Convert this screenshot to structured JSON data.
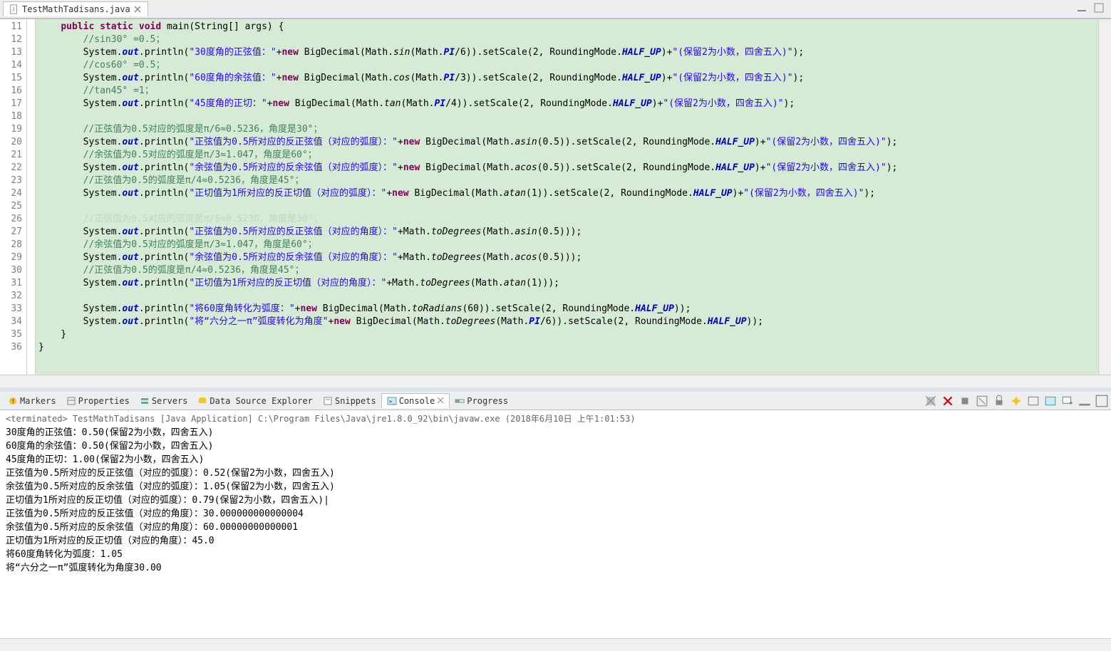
{
  "editor": {
    "tab": {
      "filename": "TestMathTadisans.java"
    },
    "lines": {
      "start": 11,
      "end": 36,
      "code": [
        {
          "n": 11,
          "html": "    <span class='kw'>public static void</span> main(String[] args) {"
        },
        {
          "n": 12,
          "html": "        <span class='com'>//sin30° =0.5；</span>"
        },
        {
          "n": 13,
          "html": "        System.<span class='fieldb'>out</span>.println(<span class='str'>\"30度角的正弦值：\"</span>+<span class='kw'>new</span> BigDecimal(Math.<span class='method-it'>sin</span>(Math.<span class='fieldb'>PI</span>/6)).setScale(2, RoundingMode.<span class='fieldb'>HALF_UP</span>)+<span class='str'>\"(保留2为小数，四舍五入)\"</span>);"
        },
        {
          "n": 14,
          "html": "        <span class='com'>//cos60° =0.5；</span>"
        },
        {
          "n": 15,
          "html": "        System.<span class='fieldb'>out</span>.println(<span class='str'>\"60度角的余弦值：\"</span>+<span class='kw'>new</span> BigDecimal(Math.<span class='method-it'>cos</span>(Math.<span class='fieldb'>PI</span>/3)).setScale(2, RoundingMode.<span class='fieldb'>HALF_UP</span>)+<span class='str'>\"(保留2为小数，四舍五入)\"</span>);"
        },
        {
          "n": 16,
          "html": "        <span class='com'>//tan45° =1；</span>"
        },
        {
          "n": 17,
          "html": "        System.<span class='fieldb'>out</span>.println(<span class='str'>\"45度角的正切：\"</span>+<span class='kw'>new</span> BigDecimal(Math.<span class='method-it'>tan</span>(Math.<span class='fieldb'>PI</span>/4)).setScale(2, RoundingMode.<span class='fieldb'>HALF_UP</span>)+<span class='str'>\"(保留2为小数，四舍五入)\"</span>);"
        },
        {
          "n": 18,
          "html": ""
        },
        {
          "n": 19,
          "html": "        <span class='com'>//正弦值为0.5对应的弧度是π/6≈0.5236，角度是30°；</span>"
        },
        {
          "n": 20,
          "html": "        System.<span class='fieldb'>out</span>.println(<span class='str'>\"正弦值为0.5所对应的反正弦值（对应的弧度）：\"</span>+<span class='kw'>new</span> BigDecimal(Math.<span class='method-it'>asin</span>(0.5)).setScale(2, RoundingMode.<span class='fieldb'>HALF_UP</span>)+<span class='str'>\"(保留2为小数，四舍五入)\"</span>);"
        },
        {
          "n": 21,
          "html": "        <span class='com'>//余弦值为0.5对应的弧度是π/3≈1.047，角度是60°；</span>"
        },
        {
          "n": 22,
          "html": "        System.<span class='fieldb'>out</span>.println(<span class='str'>\"余弦值为0.5所对应的反余弦值（对应的弧度）：\"</span>+<span class='kw'>new</span> BigDecimal(Math.<span class='method-it'>acos</span>(0.5)).setScale(2, RoundingMode.<span class='fieldb'>HALF_UP</span>)+<span class='str'>\"(保留2为小数，四舍五入)\"</span>);"
        },
        {
          "n": 23,
          "html": "        <span class='com'>//正弦值为0.5的弧度是π/4≈0.5236，角度是45°；</span>"
        },
        {
          "n": 24,
          "html": "        System.<span class='fieldb'>out</span>.println(<span class='str'>\"正切值为1所对应的反正切值（对应的弧度）：\"</span>+<span class='kw'>new</span> BigDecimal(Math.<span class='method-it'>atan</span>(1)).setScale(2, RoundingMode.<span class='fieldb'>HALF_UP</span>)+<span class='str'>\"(保留2为小数，四舍五入)\"</span>);"
        },
        {
          "n": 25,
          "html": ""
        },
        {
          "n": 26,
          "html": "        <span class='com'>//正弦值为0.5对应的弧度是π/6≈0.5236，角度是30°；</span>",
          "sel": true
        },
        {
          "n": 27,
          "html": "        System.<span class='fieldb'>out</span>.println(<span class='str'>\"正弦值为0.5所对应的反正弦值（对应的角度）：\"</span>+Math.<span class='method-it'>toDegrees</span>(Math.<span class='method-it'>asin</span>(0.5)));"
        },
        {
          "n": 28,
          "html": "        <span class='com'>//余弦值为0.5对应的弧度是π/3≈1.047，角度是60°；</span>"
        },
        {
          "n": 29,
          "html": "        System.<span class='fieldb'>out</span>.println(<span class='str'>\"余弦值为0.5所对应的反余弦值（对应的角度）：\"</span>+Math.<span class='method-it'>toDegrees</span>(Math.<span class='method-it'>acos</span>(0.5)));"
        },
        {
          "n": 30,
          "html": "        <span class='com'>//正弦值为0.5的弧度是π/4≈0.5236，角度是45°；</span>"
        },
        {
          "n": 31,
          "html": "        System.<span class='fieldb'>out</span>.println(<span class='str'>\"正切值为1所对应的反正切值（对应的角度）：\"</span>+Math.<span class='method-it'>toDegrees</span>(Math.<span class='method-it'>atan</span>(1)));"
        },
        {
          "n": 32,
          "html": ""
        },
        {
          "n": 33,
          "html": "        System.<span class='fieldb'>out</span>.println(<span class='str'>\"将60度角转化为弧度：\"</span>+<span class='kw'>new</span> BigDecimal(Math.<span class='method-it'>toRadians</span>(60)).setScale(2, RoundingMode.<span class='fieldb'>HALF_UP</span>));"
        },
        {
          "n": 34,
          "html": "        System.<span class='fieldb'>out</span>.println(<span class='str'>\"将“六分之一π”弧度转化为角度\"</span>+<span class='kw'>new</span> BigDecimal(Math.<span class='method-it'>toDegrees</span>(Math.<span class='fieldb'>PI</span>/6)).setScale(2, RoundingMode.<span class='fieldb'>HALF_UP</span>));"
        },
        {
          "n": 35,
          "html": "    }"
        },
        {
          "n": 36,
          "html": "}"
        }
      ]
    }
  },
  "views": {
    "tabs": [
      {
        "id": "markers",
        "label": "Markers",
        "active": false
      },
      {
        "id": "properties",
        "label": "Properties",
        "active": false
      },
      {
        "id": "servers",
        "label": "Servers",
        "active": false
      },
      {
        "id": "dse",
        "label": "Data Source Explorer",
        "active": false
      },
      {
        "id": "snippets",
        "label": "Snippets",
        "active": false
      },
      {
        "id": "console",
        "label": "Console",
        "active": true
      },
      {
        "id": "progress",
        "label": "Progress",
        "active": false
      }
    ]
  },
  "console": {
    "header": "<terminated> TestMathTadisans [Java Application] C:\\Program Files\\Java\\jre1.8.0_92\\bin\\javaw.exe (2018年6月10日 上午1:01:53)",
    "lines": [
      "30度角的正弦值：0.50(保留2为小数，四舍五入)",
      "60度角的余弦值：0.50(保留2为小数，四舍五入)",
      "45度角的正切：1.00(保留2为小数，四舍五入)",
      "正弦值为0.5所对应的反正弦值（对应的弧度）：0.52(保留2为小数，四舍五入)",
      "余弦值为0.5所对应的反余弦值（对应的弧度）：1.05(保留2为小数，四舍五入)",
      "正切值为1所对应的反正切值（对应的弧度）：0.79(保留2为小数，四舍五入)|",
      "正弦值为0.5所对应的反正弦值（对应的角度）：30.000000000000004",
      "余弦值为0.5所对应的反余弦值（对应的角度）：60.00000000000001",
      "正切值为1所对应的反正切值（对应的角度）：45.0",
      "将60度角转化为弧度：1.05",
      "将“六分之一π”弧度转化为角度30.00"
    ]
  }
}
